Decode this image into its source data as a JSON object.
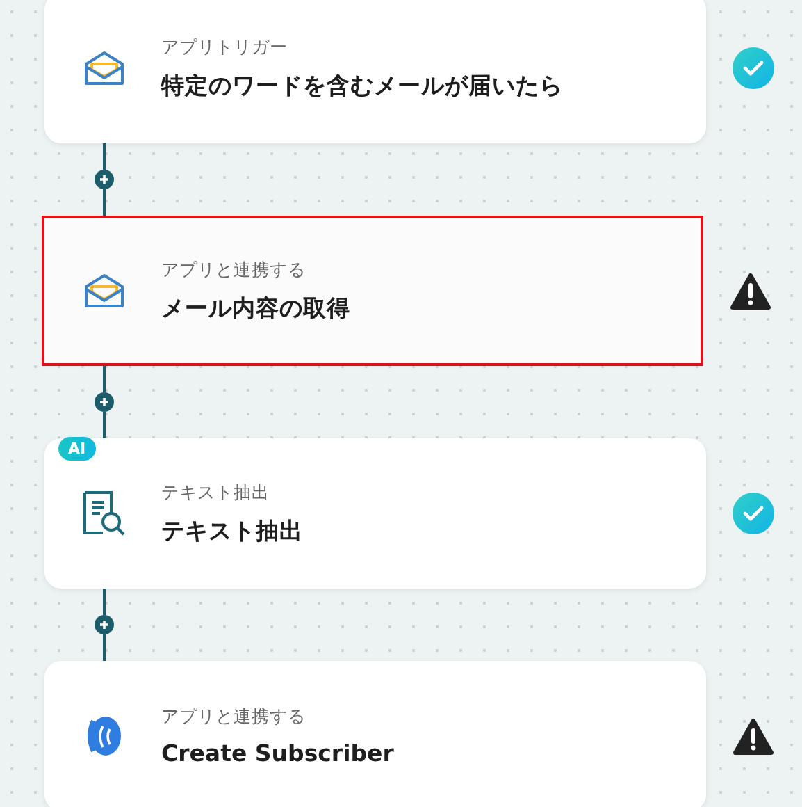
{
  "steps": [
    {
      "kind": "mail",
      "label": "アプリトリガー",
      "title": "特定のワードを含むメールが届いたら",
      "complete": true,
      "selected": false
    },
    {
      "kind": "mail",
      "label": "アプリと連携する",
      "title": "メール内容の取得",
      "complete": false,
      "selected": true
    },
    {
      "kind": "extract",
      "badge": "AI",
      "label": "テキスト抽出",
      "title": "テキスト抽出",
      "complete": true,
      "selected": false
    },
    {
      "kind": "app",
      "label": "アプリと連携する",
      "title": "Create Subscriber",
      "complete": false,
      "selected": false
    }
  ]
}
